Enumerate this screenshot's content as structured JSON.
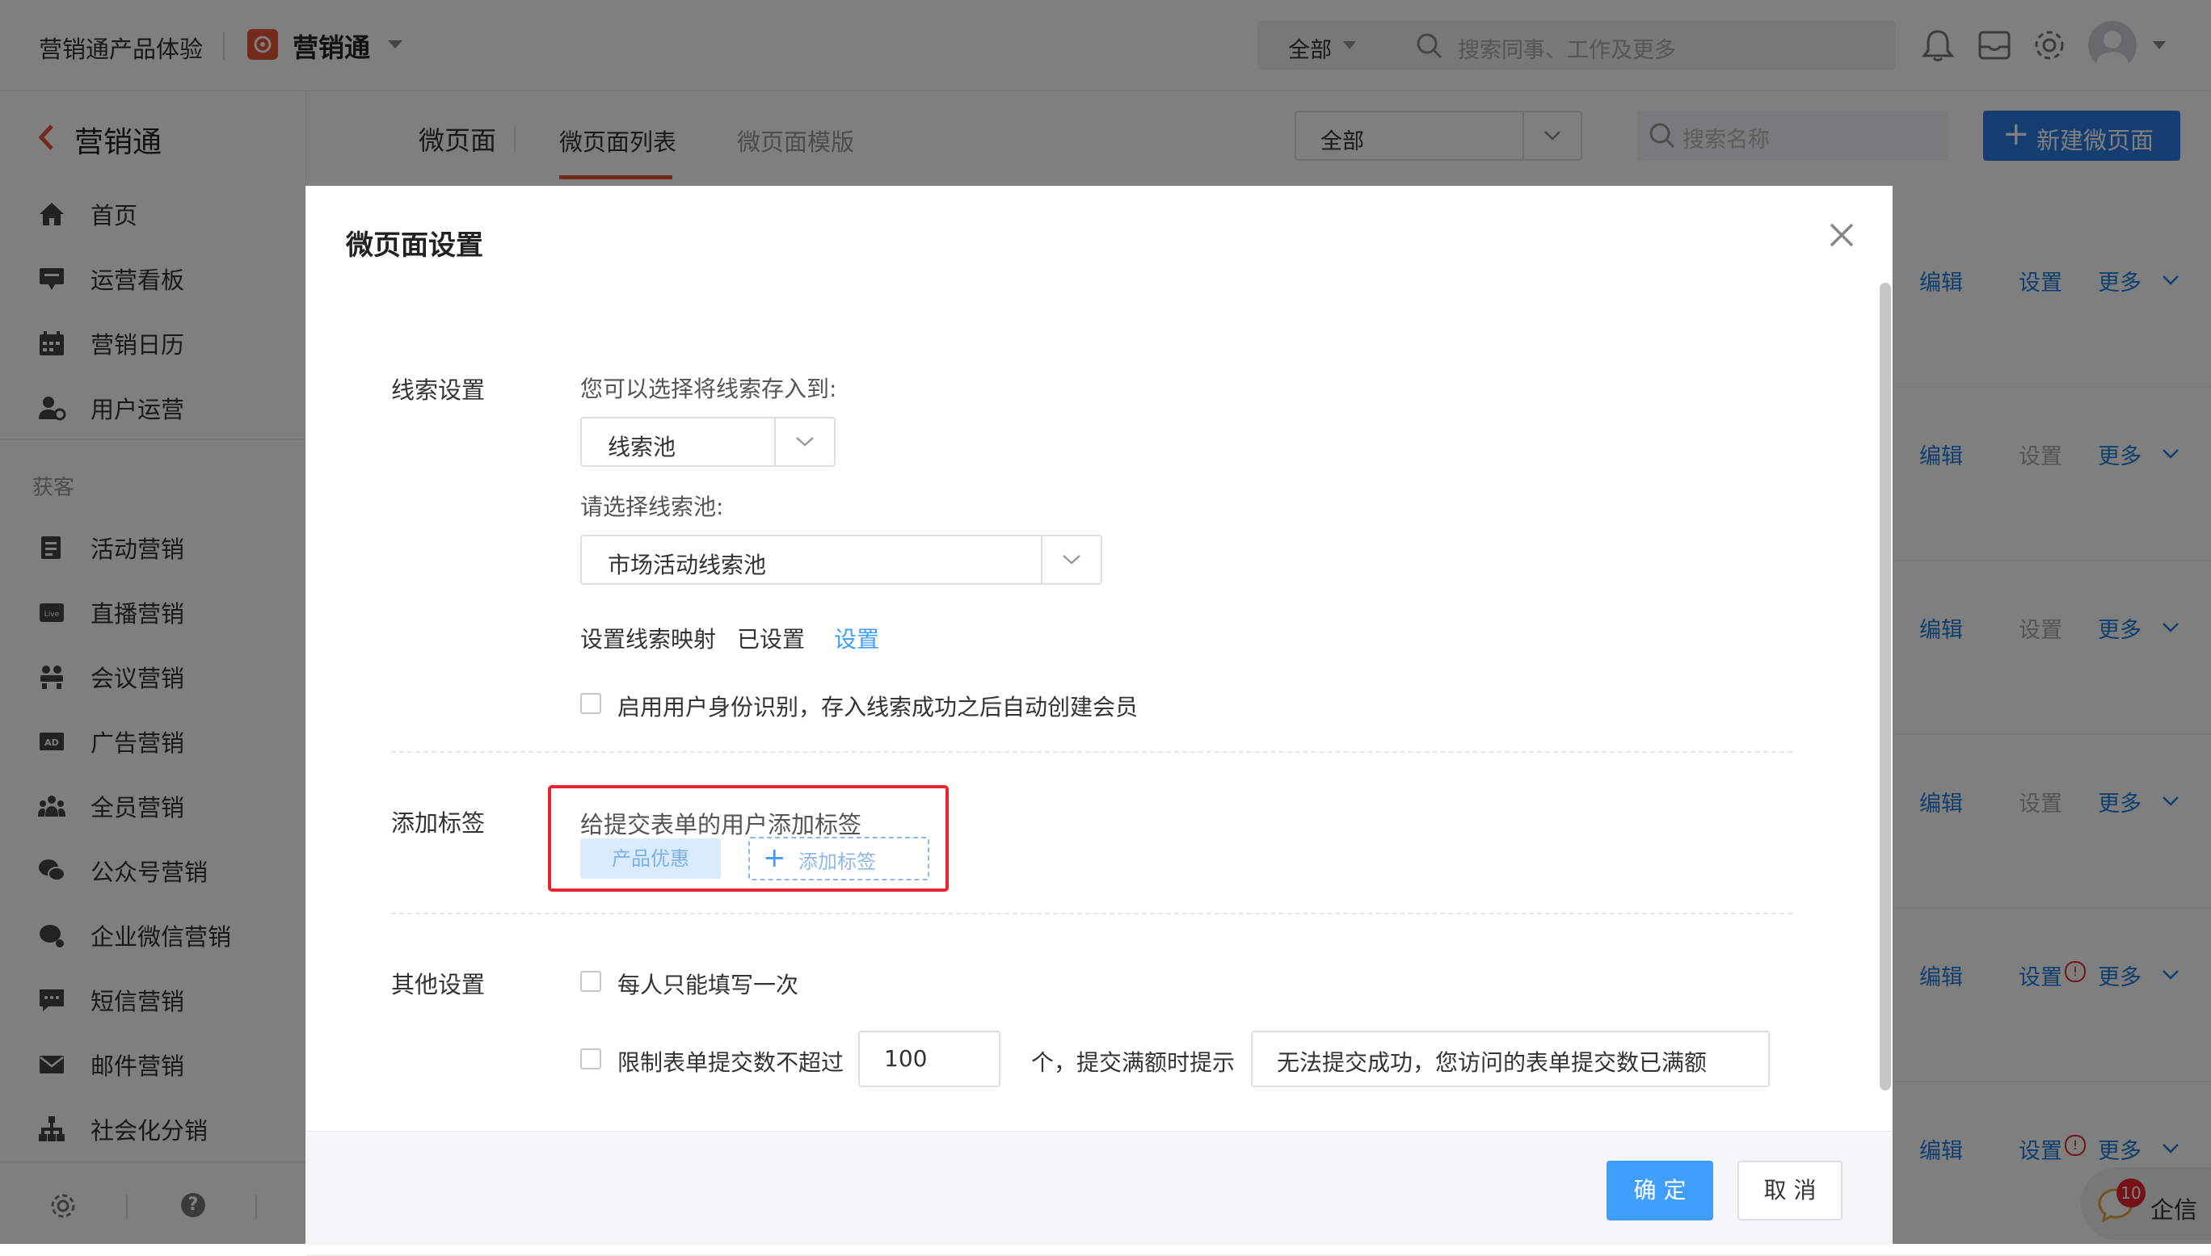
{
  "topbar": {
    "product_name": "营销通产品体验",
    "app_name": "营销通",
    "scope_select": "全部",
    "search_placeholder": "搜索同事、工作及更多"
  },
  "sidebar": {
    "back_label": "营销通",
    "items": [
      {
        "label": "首页",
        "icon": "home-icon"
      },
      {
        "label": "运营看板",
        "icon": "dashboard-icon"
      },
      {
        "label": "营销日历",
        "icon": "calendar-icon"
      },
      {
        "label": "用户运营",
        "icon": "user-ops-icon"
      }
    ],
    "section_title": "获客",
    "acq_items": [
      {
        "label": "活动营销",
        "icon": "activity-icon"
      },
      {
        "label": "直播营销",
        "icon": "live-icon"
      },
      {
        "label": "会议营销",
        "icon": "meeting-icon"
      },
      {
        "label": "广告营销",
        "icon": "ad-icon"
      },
      {
        "label": "全员营销",
        "icon": "team-icon"
      },
      {
        "label": "公众号营销",
        "icon": "wechat-icon"
      },
      {
        "label": "企业微信营销",
        "icon": "work-wechat-icon"
      },
      {
        "label": "短信营销",
        "icon": "sms-icon"
      },
      {
        "label": "邮件营销",
        "icon": "mail-icon"
      },
      {
        "label": "社会化分销",
        "icon": "distribution-icon"
      }
    ]
  },
  "main": {
    "page_title": "微页面",
    "tabs": [
      "微页面列表",
      "微页面模版"
    ],
    "filter_select": "全部",
    "search_placeholder": "搜索名称",
    "new_button": "新建微页面",
    "row_actions": {
      "edit": "编辑",
      "settings": "设置",
      "more": "更多"
    },
    "chat_badge": "10",
    "chat_label": "企信"
  },
  "modal": {
    "title": "微页面设置",
    "clue": {
      "label": "线索设置",
      "store_prompt": "您可以选择将线索存入到:",
      "store_select": "线索池",
      "pool_prompt": "请选择线索池:",
      "pool_select": "市场活动线索池",
      "mapping_label": "设置线索映射",
      "mapping_status": "已设置",
      "mapping_link": "设置",
      "identity_checkbox": "启用用户身份识别，存入线索成功之后自动创建会员"
    },
    "tags": {
      "label": "添加标签",
      "prompt": "给提交表单的用户添加标签",
      "tag": "产品优惠",
      "add_button": "添加标签"
    },
    "other": {
      "label": "其他设置",
      "once_checkbox": "每人只能填写一次",
      "limit_checkbox": "限制表单提交数不超过",
      "limit_value": "100",
      "limit_suffix": "个，提交满额时提示",
      "limit_message": "无法提交成功，您访问的表单提交数已满额"
    },
    "confirm_button": "确 定",
    "cancel_button": "取 消"
  },
  "colors": {
    "primary": "#409eff",
    "link": "#1f7dd8",
    "highlight_box": "#e8252e",
    "new_button": "#2a7ae2"
  }
}
